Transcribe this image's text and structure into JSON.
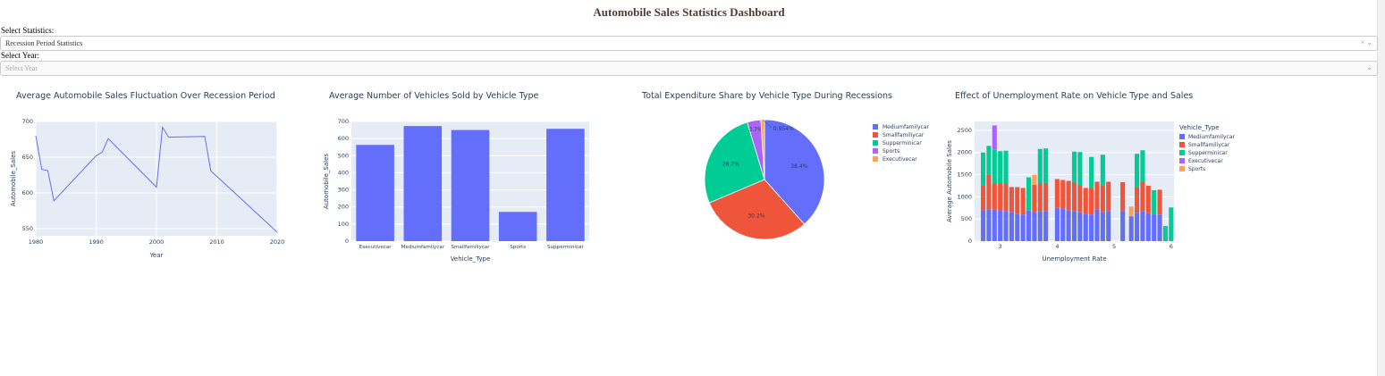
{
  "page_title": "Automobile Sales Statistics Dashboard",
  "statistics_dropdown": {
    "label": "Select Statistics:",
    "value": "Recession Period Statistics"
  },
  "year_dropdown": {
    "label": "Select Year:",
    "placeholder": "Select Year"
  },
  "colors": {
    "blue": "#636efa",
    "red": "#ef553b",
    "green": "#00cc96",
    "purple": "#ab63fa",
    "orange": "#ffa15a",
    "plot_bg": "#e5ecf6",
    "title_text": "#503d36"
  },
  "chart_data": [
    {
      "type": "line",
      "title": "Average Automobile Sales Fluctuation Over Recession Period",
      "xlabel": "Year",
      "ylabel": "Automobile_Sales",
      "xlim": [
        1980,
        2020
      ],
      "ylim": [
        540,
        700
      ],
      "xticks": [
        1980,
        1990,
        2000,
        2010,
        2020
      ],
      "yticks": [
        550,
        600,
        650,
        700
      ],
      "x": [
        1980,
        1981,
        1982,
        1983,
        1990,
        1991,
        1992,
        2000,
        2001,
        2002,
        2008,
        2009,
        2020
      ],
      "y": [
        680,
        633,
        631,
        589,
        652,
        657,
        676,
        608,
        692,
        678,
        679,
        631,
        545
      ]
    },
    {
      "type": "bar",
      "title": "Average Number of Vehicles Sold by Vehicle Type",
      "xlabel": "Vehicle_Type",
      "ylabel": "Automobile_Sales",
      "ylim": [
        0,
        700
      ],
      "yticks": [
        0,
        100,
        200,
        300,
        400,
        500,
        600,
        700
      ],
      "categories": [
        "Executivecar",
        "Mediumfamilycar",
        "Smallfamiliycar",
        "Sports",
        "Supperminicar"
      ],
      "values": [
        563,
        673,
        650,
        171,
        657
      ]
    },
    {
      "type": "pie",
      "title": "Total Expenditure Share by Vehicle Type During Recessions",
      "labels": [
        "Mediumfamilycar",
        "Smallfamiliycar",
        "Supperminicar",
        "Sports",
        "Executivecar"
      ],
      "values": [
        38.4,
        30.2,
        26.7,
        3.7,
        0.954
      ],
      "text_labels": [
        "38.4%",
        "30.2%",
        "26.7%",
        "3.7%",
        "0.954%"
      ]
    },
    {
      "type": "bar",
      "title": "Effect of Unemployment Rate on Vehicle Type and Sales",
      "xlabel": "Unemployment Rate",
      "ylabel": "Average Automobile Sales",
      "legend_title": "Vehicle_Type",
      "xlim": [
        2.55,
        6.05
      ],
      "ylim": [
        0,
        2700
      ],
      "xticks": [
        3,
        4,
        5,
        6
      ],
      "yticks": [
        0,
        500,
        1000,
        1500,
        2000,
        2500
      ],
      "series_names": [
        "Mediumfamilycar",
        "Smallfamiliycar",
        "Supperminicar",
        "Executivecar",
        "Sports"
      ],
      "bars": [
        {
          "x": 2.7,
          "values": [
            700,
            550,
            750,
            0,
            0
          ]
        },
        {
          "x": 2.8,
          "values": [
            720,
            780,
            650,
            0,
            0
          ]
        },
        {
          "x": 2.9,
          "values": [
            710,
            600,
            750,
            550,
            0
          ]
        },
        {
          "x": 3.0,
          "values": [
            700,
            610,
            720,
            0,
            0
          ]
        },
        {
          "x": 3.1,
          "values": [
            680,
            620,
            740,
            0,
            0
          ]
        },
        {
          "x": 3.2,
          "values": [
            660,
            560,
            0,
            0,
            0
          ]
        },
        {
          "x": 3.3,
          "values": [
            620,
            600,
            0,
            0,
            0
          ]
        },
        {
          "x": 3.4,
          "values": [
            600,
            600,
            0,
            0,
            0
          ]
        },
        {
          "x": 3.5,
          "values": [
            690,
            0,
            750,
            0,
            0
          ]
        },
        {
          "x": 3.6,
          "values": [
            650,
            620,
            0,
            0,
            230
          ]
        },
        {
          "x": 3.7,
          "values": [
            680,
            620,
            780,
            0,
            0
          ]
        },
        {
          "x": 3.8,
          "values": [
            680,
            630,
            780,
            0,
            0
          ]
        },
        {
          "x": 4.0,
          "values": [
            750,
            650,
            0,
            0,
            0
          ]
        },
        {
          "x": 4.1,
          "values": [
            740,
            640,
            0,
            0,
            0
          ]
        },
        {
          "x": 4.2,
          "values": [
            700,
            660,
            0,
            0,
            0
          ]
        },
        {
          "x": 4.3,
          "values": [
            680,
            640,
            700,
            0,
            0
          ]
        },
        {
          "x": 4.4,
          "values": [
            650,
            610,
            750,
            0,
            0
          ]
        },
        {
          "x": 4.5,
          "values": [
            620,
            580,
            0,
            0,
            0
          ]
        },
        {
          "x": 4.6,
          "values": [
            600,
            600,
            700,
            0,
            0
          ]
        },
        {
          "x": 4.7,
          "values": [
            720,
            620,
            0,
            0,
            0
          ]
        },
        {
          "x": 4.8,
          "values": [
            650,
            600,
            700,
            0,
            0
          ]
        },
        {
          "x": 4.9,
          "values": [
            680,
            660,
            0,
            0,
            0
          ]
        },
        {
          "x": 5.15,
          "values": [
            680,
            650,
            0,
            0,
            0
          ]
        },
        {
          "x": 5.3,
          "values": [
            560,
            0,
            0,
            0,
            220
          ]
        },
        {
          "x": 5.4,
          "values": [
            640,
            580,
            750,
            0,
            0
          ]
        },
        {
          "x": 5.5,
          "values": [
            680,
            650,
            720,
            0,
            0
          ]
        },
        {
          "x": 5.6,
          "values": [
            630,
            620,
            0,
            0,
            0
          ]
        },
        {
          "x": 5.7,
          "values": [
            600,
            0,
            550,
            0,
            0
          ]
        },
        {
          "x": 5.8,
          "values": [
            600,
            560,
            0,
            0,
            0
          ]
        },
        {
          "x": 5.9,
          "values": [
            0,
            0,
            340,
            0,
            0
          ]
        },
        {
          "x": 6.0,
          "values": [
            0,
            0,
            760,
            0,
            0
          ]
        }
      ]
    }
  ]
}
